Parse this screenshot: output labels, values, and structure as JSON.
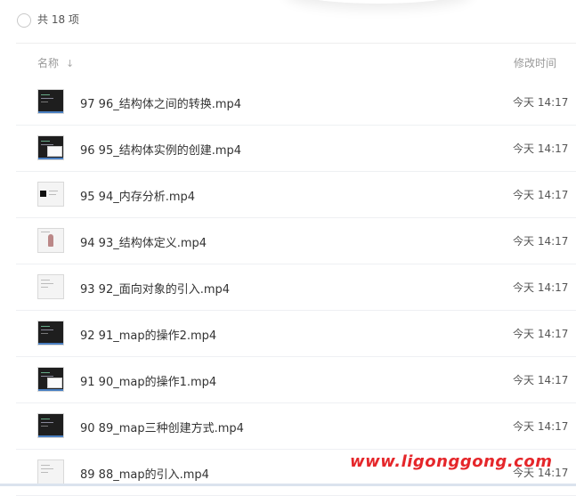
{
  "header": {
    "count_text": "共 18 项"
  },
  "columns": {
    "name": "名称",
    "sort_icon": "arrow-down",
    "time": "修改时间"
  },
  "files": [
    {
      "name": "97 96_结构体之间的转换.mp4",
      "time": "今天 14:17",
      "thumb": "dark-code"
    },
    {
      "name": "96 95_结构体实例的创建.mp4",
      "time": "今天 14:17",
      "thumb": "dark-window"
    },
    {
      "name": "95 94_内存分析.mp4",
      "time": "今天 14:17",
      "thumb": "light-diagram"
    },
    {
      "name": "94 93_结构体定义.mp4",
      "time": "今天 14:17",
      "thumb": "light-person"
    },
    {
      "name": "93 92_面向对象的引入.mp4",
      "time": "今天 14:17",
      "thumb": "light-doc"
    },
    {
      "name": "92 91_map的操作2.mp4",
      "time": "今天 14:17",
      "thumb": "dark-code"
    },
    {
      "name": "91 90_map的操作1.mp4",
      "time": "今天 14:17",
      "thumb": "dark-window"
    },
    {
      "name": "90 89_map三种创建方式.mp4",
      "time": "今天 14:17",
      "thumb": "dark-code"
    },
    {
      "name": "89 88_map的引入.mp4",
      "time": "今天 14:17",
      "thumb": "light-doc"
    }
  ],
  "watermark": "www.ligonggong.com",
  "colors": {
    "watermark": "#e5262a",
    "divider": "#eef0f3",
    "text": "#333333",
    "muted": "#999999"
  }
}
